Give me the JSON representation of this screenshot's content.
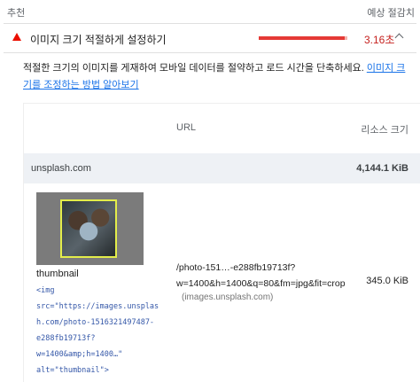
{
  "header": {
    "left": "추천",
    "right": "예상 절감치"
  },
  "audit": {
    "icon": "fail-triangle-icon",
    "title": "이미지 크기 적절하게 설정하기",
    "savings": "3.16초",
    "bar_fraction": 0.97,
    "color_fail": "#eb0f00"
  },
  "description": {
    "text": "적절한 크기의 이미지를 게재하여 모바일 데이터를 절약하고 로드 시간을 단축하세요. ",
    "link": "이미지 크기를 조정하는 방법 알아보기"
  },
  "table": {
    "headers": {
      "url": "URL",
      "size": "리소스 크기"
    },
    "group": {
      "name": "unsplash.com",
      "size": "4,144.1 KiB"
    },
    "item": {
      "thumb_label": "thumbnail",
      "code": "<img\nsrc=\"https://images.unsplas\nh.com/photo-1516321497487-\ne288fb19713f?\nw=1400&amp;h=1400…\"\nalt=\"thumbnail\">",
      "url_line1": "/photo-151…-e288fb19713f?",
      "url_line2": "w=1400&h=1400&q=80&fm=jpg&fit=crop",
      "domain": "(images.unsplash.com)",
      "size": "345.0 KiB"
    }
  }
}
